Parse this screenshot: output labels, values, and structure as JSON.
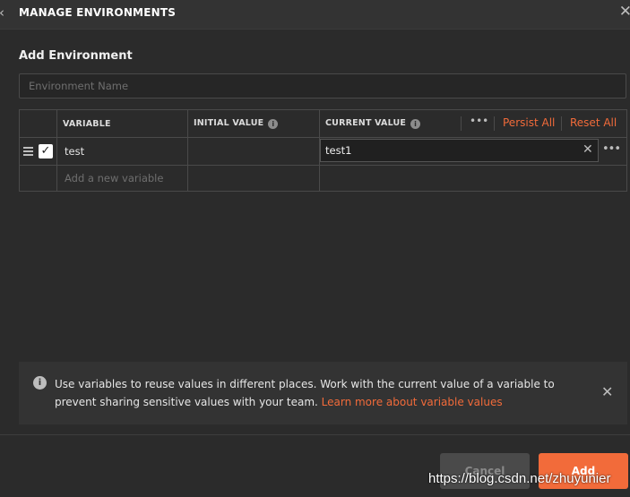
{
  "window": {
    "title": "MANAGE ENVIRONMENTS"
  },
  "form": {
    "section_label": "Add Environment",
    "env_name_placeholder": "Environment Name",
    "env_name_value": ""
  },
  "table": {
    "headers": {
      "variable": "VARIABLE",
      "initial_value": "INITIAL VALUE",
      "current_value": "CURRENT VALUE"
    },
    "actions": {
      "more": "•••",
      "persist_all": "Persist All",
      "reset_all": "Reset All"
    },
    "rows": [
      {
        "enabled": true,
        "variable": "test",
        "initial_value": "",
        "current_value": "test1"
      }
    ],
    "new_variable_placeholder": "Add a new variable"
  },
  "notice": {
    "text": "Use variables to reuse values in different places. Work with the current value of a variable to prevent sharing sensitive values with your team. ",
    "link": "Learn more about variable values"
  },
  "footer": {
    "cancel_label": "Cancel",
    "add_label": "Add"
  },
  "watermark": "https://blog.csdn.net/zhuyunier",
  "colors": {
    "accent": "#f26b3a",
    "background": "#2b2b2b",
    "panel": "#333333"
  },
  "icons": {
    "back": "chevron-left-icon",
    "close": "close-icon",
    "info": "info-icon",
    "drag": "drag-handle-icon",
    "more": "more-dots-icon"
  }
}
